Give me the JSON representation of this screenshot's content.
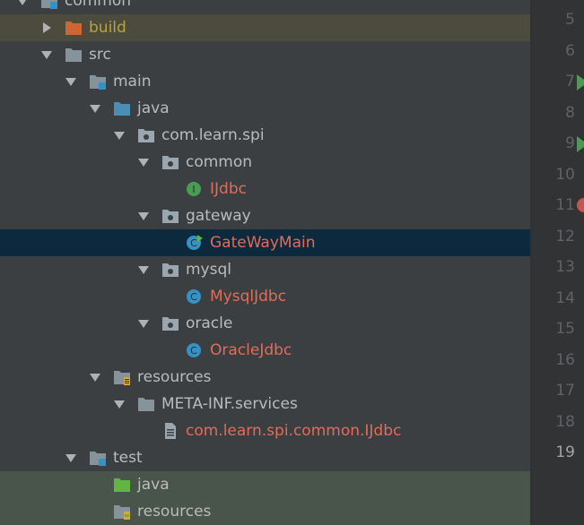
{
  "tree": {
    "items": [
      {
        "label": "common",
        "icon": "module-folder-icon",
        "arrow": "down",
        "depth": 0,
        "style": "normal",
        "row": "normal"
      },
      {
        "label": "build",
        "icon": "excluded-folder-icon",
        "arrow": "right",
        "depth": 1,
        "style": "excluded",
        "row": "excluded"
      },
      {
        "label": "src",
        "icon": "folder-icon",
        "arrow": "down",
        "depth": 1,
        "style": "normal",
        "row": "normal"
      },
      {
        "label": "main",
        "icon": "module-folder-icon",
        "arrow": "down",
        "depth": 2,
        "style": "normal",
        "row": "normal"
      },
      {
        "label": "java",
        "icon": "source-root-icon",
        "arrow": "down",
        "depth": 3,
        "style": "normal",
        "row": "normal"
      },
      {
        "label": "com.learn.spi",
        "icon": "package-icon",
        "arrow": "down",
        "depth": 4,
        "style": "normal",
        "row": "normal"
      },
      {
        "label": "common",
        "icon": "package-icon",
        "arrow": "down",
        "depth": 5,
        "style": "normal",
        "row": "normal"
      },
      {
        "label": "IJdbc",
        "icon": "interface-icon",
        "arrow": "none",
        "depth": 6,
        "style": "interface",
        "row": "normal"
      },
      {
        "label": "gateway",
        "icon": "package-icon",
        "arrow": "down",
        "depth": 5,
        "style": "normal",
        "row": "normal"
      },
      {
        "label": "GateWayMain",
        "icon": "class-runnable-icon",
        "arrow": "none",
        "depth": 6,
        "style": "class",
        "row": "selected"
      },
      {
        "label": "mysql",
        "icon": "package-icon",
        "arrow": "down",
        "depth": 5,
        "style": "normal",
        "row": "normal"
      },
      {
        "label": "MysqlJdbc",
        "icon": "class-icon",
        "arrow": "none",
        "depth": 6,
        "style": "class",
        "row": "normal"
      },
      {
        "label": "oracle",
        "icon": "package-icon",
        "arrow": "down",
        "depth": 5,
        "style": "normal",
        "row": "normal"
      },
      {
        "label": "OracleJdbc",
        "icon": "class-icon",
        "arrow": "none",
        "depth": 6,
        "style": "class",
        "row": "normal"
      },
      {
        "label": "resources",
        "icon": "resources-root-icon",
        "arrow": "down",
        "depth": 3,
        "style": "normal",
        "row": "normal"
      },
      {
        "label": "META-INF.services",
        "icon": "folder-icon",
        "arrow": "down",
        "depth": 4,
        "style": "normal",
        "row": "normal"
      },
      {
        "label": "com.learn.spi.common.IJdbc",
        "icon": "text-file-icon",
        "arrow": "none",
        "depth": 5,
        "style": "class",
        "row": "normal"
      },
      {
        "label": "test",
        "icon": "module-folder-icon",
        "arrow": "down",
        "depth": 2,
        "style": "normal",
        "row": "normal"
      },
      {
        "label": "java",
        "icon": "test-root-icon",
        "arrow": "none",
        "depth": 3,
        "style": "normal",
        "row": "test-root"
      },
      {
        "label": "resources",
        "icon": "test-resources-root-icon",
        "arrow": "none",
        "depth": 3,
        "style": "normal",
        "row": "test-root"
      }
    ]
  },
  "gutter": {
    "lines": [
      {
        "n": "5",
        "mark": ""
      },
      {
        "n": "6",
        "mark": ""
      },
      {
        "n": "7",
        "mark": "run"
      },
      {
        "n": "8",
        "mark": ""
      },
      {
        "n": "9",
        "mark": "run"
      },
      {
        "n": "10",
        "mark": ""
      },
      {
        "n": "11",
        "mark": "breakpoint"
      },
      {
        "n": "12",
        "mark": ""
      },
      {
        "n": "13",
        "mark": ""
      },
      {
        "n": "14",
        "mark": ""
      },
      {
        "n": "15",
        "mark": ""
      },
      {
        "n": "16",
        "mark": ""
      },
      {
        "n": "17",
        "mark": ""
      },
      {
        "n": "18",
        "mark": ""
      },
      {
        "n": "19",
        "mark": "current"
      }
    ]
  },
  "colors": {
    "folder": "#87939a",
    "source_root": "#4a8db7",
    "test_root": "#62b543",
    "package_bg": "#9aa7b0",
    "interface": "#499c54",
    "class": "#3592c4",
    "class_text": "#e06c5a",
    "excluded_text": "#b5a43f",
    "excluded_folder": "#cc6633"
  }
}
